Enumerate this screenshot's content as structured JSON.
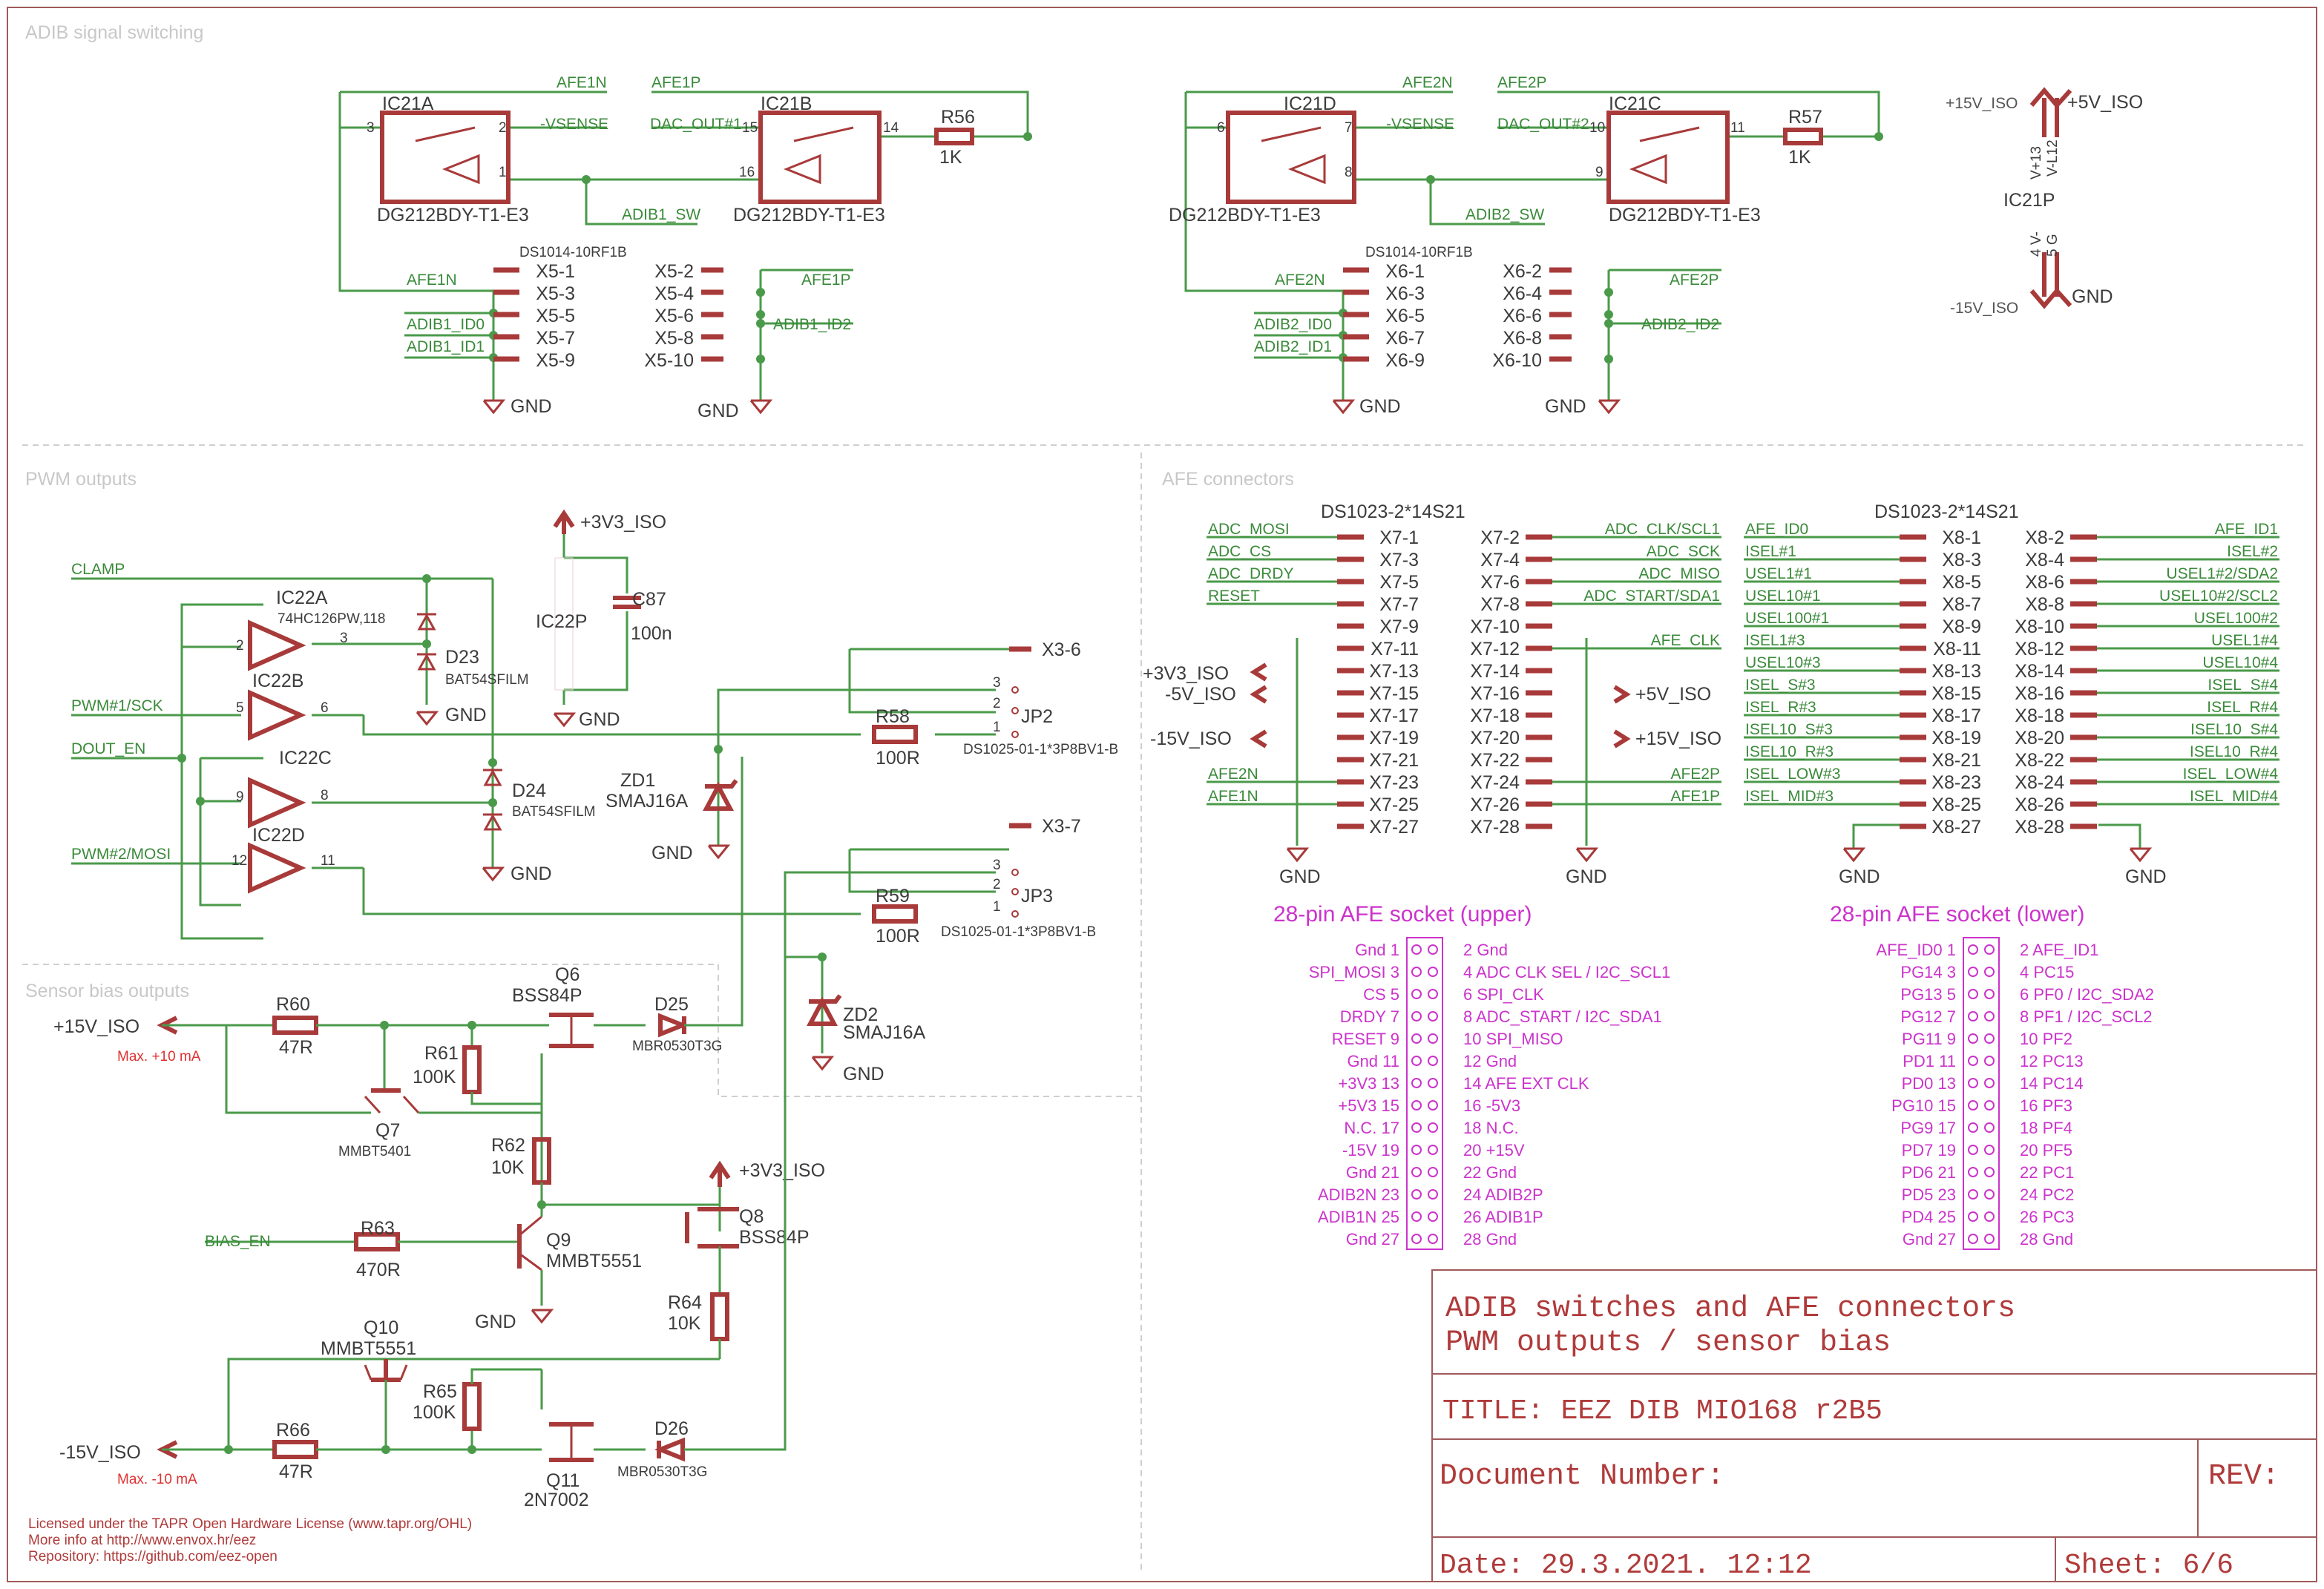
{
  "sections": {
    "adib": "ADIB signal switching",
    "pwm": "PWM outputs",
    "afe": "AFE connectors",
    "bias": "Sensor bias outputs"
  },
  "parts": {
    "ic21a": "IC21A",
    "ic21b": "IC21B",
    "ic21c": "IC21C",
    "ic21d": "IC21D",
    "ic21p": "IC21P",
    "dg": "DG212BDY-T1-E3",
    "r56": "R56",
    "r57": "R57",
    "v1k": "1K",
    "ds1014": "DS1014-10RF1B",
    "ic22a": "IC22A",
    "ic22b": "IC22B",
    "ic22c": "IC22C",
    "ic22d": "IC22D",
    "ic22p": "IC22P",
    "hc126": "74HC126PW,118",
    "d23": "D23",
    "d24": "D24",
    "bat": "BAT54SFILM",
    "c87": "C87",
    "v100n": "100n",
    "zd1": "ZD1",
    "zd2": "ZD2",
    "smaj": "SMAJ16A",
    "r58": "R58",
    "r59": "R59",
    "v100r": "100R",
    "jp2": "JP2",
    "jp3": "JP3",
    "ds1025": "DS1025-01-1*3P8BV1-B",
    "x36": "X3-6",
    "x37": "X3-7",
    "r60": "R60",
    "r61": "R61",
    "r62": "R62",
    "r63": "R63",
    "r64": "R64",
    "r65": "R65",
    "r66": "R66",
    "v47r": "47R",
    "v100k": "100K",
    "v10k": "10K",
    "v470r": "470R",
    "q6": "Q6",
    "q7": "Q7",
    "q8": "Q8",
    "q9": "Q9",
    "q10": "Q10",
    "q11": "Q11",
    "bss84p": "BSS84P",
    "mmbt5401": "MMBT5401",
    "mmbt5551": "MMBT5551",
    "n7002": "2N7002",
    "d25": "D25",
    "d26": "D26",
    "mbr": "MBR0530T3G",
    "ds1023a": "DS1023-2*14S21",
    "ds1023b": "DS1023-2*14S21",
    "v13": "V+13",
    "v12": "V-L12",
    "v4": "4 V-",
    "v5": "5 G"
  },
  "nets": {
    "afe1n": "AFE1N",
    "afe1p": "AFE1P",
    "afe2n": "AFE2N",
    "afe2p": "AFE2P",
    "vsense": "-VSENSE",
    "dac1": "DAC_OUT#1",
    "dac2": "DAC_OUT#2",
    "adib1sw": "ADIB1_SW",
    "adib2sw": "ADIB2_SW",
    "adib1id0": "ADIB1_ID0",
    "adib1id1": "ADIB1_ID1",
    "adib2id0": "ADIB2_ID0",
    "adib2id1": "ADIB2_ID1",
    "adib1id2": "ADIB1_ID2",
    "adib2id2": "ADIB2_ID2",
    "gnd": "GND",
    "p15iso": "+15V_ISO",
    "m15iso": "-15V_ISO",
    "p5iso": "+5V_ISO",
    "m5iso": "-5V_ISO",
    "p3v3": "+3V3_ISO",
    "clamp": "CLAMP",
    "pwm1": "PWM#1/SCK",
    "pwm2": "PWM#2/MOSI",
    "douten": "DOUT_EN",
    "biasen": "BIAS_EN",
    "maxp": "Max. +10 mA",
    "maxm": "Max. -10 mA"
  },
  "x5": {
    "left": [
      "X5-1",
      "X5-3",
      "X5-5",
      "X5-7",
      "X5-9"
    ],
    "right": [
      "X5-2",
      "X5-4",
      "X5-6",
      "X5-8",
      "X5-10"
    ]
  },
  "x6": {
    "left": [
      "X6-1",
      "X6-3",
      "X6-5",
      "X6-7",
      "X6-9"
    ],
    "right": [
      "X6-2",
      "X6-4",
      "X6-6",
      "X6-8",
      "X6-10"
    ]
  },
  "x7": {
    "left": [
      "X7-1",
      "X7-3",
      "X7-5",
      "X7-7",
      "X7-9",
      "X7-11",
      "X7-13",
      "X7-15",
      "X7-17",
      "X7-19",
      "X7-21",
      "X7-23",
      "X7-25",
      "X7-27"
    ],
    "right": [
      "X7-2",
      "X7-4",
      "X7-6",
      "X7-8",
      "X7-10",
      "X7-12",
      "X7-14",
      "X7-16",
      "X7-18",
      "X7-20",
      "X7-22",
      "X7-24",
      "X7-26",
      "X7-28"
    ],
    "lnets": [
      "ADC_MOSI",
      "ADC_CS",
      "ADC_DRDY",
      "RESET",
      "",
      "",
      "",
      "",
      "",
      "",
      "",
      "AFE2N",
      "AFE1N",
      ""
    ],
    "rnets": [
      "ADC_CLK/SCL1",
      "ADC_SCK",
      "ADC_MISO",
      "ADC_START/SDA1",
      "",
      "AFE_CLK",
      "",
      "",
      "",
      "",
      "",
      "AFE2P",
      "AFE1P",
      ""
    ]
  },
  "x8": {
    "left": [
      "X8-1",
      "X8-3",
      "X8-5",
      "X8-7",
      "X8-9",
      "X8-11",
      "X8-13",
      "X8-15",
      "X8-17",
      "X8-19",
      "X8-21",
      "X8-23",
      "X8-25",
      "X8-27"
    ],
    "right": [
      "X8-2",
      "X8-4",
      "X8-6",
      "X8-8",
      "X8-10",
      "X8-12",
      "X8-14",
      "X8-16",
      "X8-18",
      "X8-20",
      "X8-22",
      "X8-24",
      "X8-26",
      "X8-28"
    ],
    "lnets": [
      "AFE_ID0",
      "ISEL#1",
      "USEL1#1",
      "USEL10#1",
      "USEL100#1",
      "ISEL1#3",
      "USEL10#3",
      "ISEL_S#3",
      "ISEL_R#3",
      "ISEL10_S#3",
      "ISEL10_R#3",
      "ISEL_LOW#3",
      "ISEL_MID#3",
      ""
    ],
    "rnets": [
      "AFE_ID1",
      "ISEL#2",
      "USEL1#2/SDA2",
      "USEL10#2/SCL2",
      "USEL100#2",
      "USEL1#4",
      "USEL10#4",
      "ISEL_S#4",
      "ISEL_R#4",
      "ISEL10_S#4",
      "ISEL10_R#4",
      "ISEL_LOW#4",
      "ISEL_MID#4",
      ""
    ]
  },
  "upper_socket": {
    "title": "28-pin AFE socket (upper)",
    "left": [
      "Gnd 1",
      "SPI_MOSI 3",
      "CS 5",
      "DRDY 7",
      "RESET 9",
      "Gnd 11",
      "+3V3 13",
      "+5V3 15",
      "N.C. 17",
      "-15V 19",
      "Gnd 21",
      "ADIB2N 23",
      "ADIB1N 25",
      "Gnd 27"
    ],
    "right": [
      "2 Gnd",
      "4 ADC CLK SEL / I2C_SCL1",
      "6 SPI_CLK",
      "8 ADC_START / I2C_SDA1",
      "10 SPI_MISO",
      "12 Gnd",
      "14 AFE EXT CLK",
      "16 -5V3",
      "18 N.C.",
      "20 +15V",
      "22 Gnd",
      "24 ADIB2P",
      "26 ADIB1P",
      "28 Gnd"
    ]
  },
  "lower_socket": {
    "title": "28-pin AFE socket (lower)",
    "left": [
      "AFE_ID0 1",
      "PG14 3",
      "PG13 5",
      "PG12 7",
      "PG11 9",
      "PD1 11",
      "PD0 13",
      "PG10 15",
      "PG9 17",
      "PD7 19",
      "PD6 21",
      "PD5 23",
      "PD4 25",
      "Gnd 27"
    ],
    "right": [
      "2 AFE_ID1",
      "4 PC15",
      "6 PF0 / I2C_SDA2",
      "8 PF1 / I2C_SCL2",
      "10 PF2",
      "12 PC13",
      "14 PC14",
      "16 PF3",
      "18 PF4",
      "20 PF5",
      "22 PC1",
      "24 PC2",
      "26 PC3",
      "28 Gnd"
    ]
  },
  "title_block": {
    "line1": "ADIB switches and AFE connectors",
    "line2": "PWM outputs / sensor bias",
    "title": "TITLE:  EEZ DIB MIO168 r2B5",
    "docnum": "Document Number:",
    "rev": "REV:",
    "date": "Date: 29.3.2021. 12:12",
    "sheet": "Sheet: 6/6"
  },
  "license": {
    "line1": "Licensed under the TAPR Open Hardware License (www.tapr.org/OHL)",
    "line2": "More info at http://www.envox.hr/eez",
    "line3": "Repository: https://github.com/eez-open"
  }
}
